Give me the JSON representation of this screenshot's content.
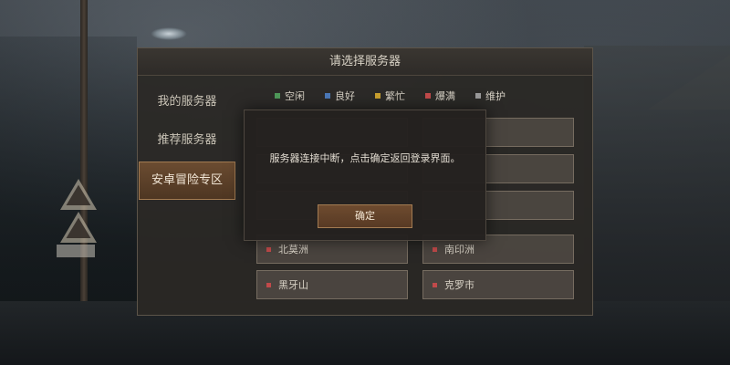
{
  "panel": {
    "title": "请选择服务器",
    "sidebar": [
      "我的服务器",
      "推荐服务器",
      "安卓冒险专区"
    ],
    "legend": [
      {
        "label": "空闲",
        "color": "#4f9a5a"
      },
      {
        "label": "良好",
        "color": "#4b78b8"
      },
      {
        "label": "繁忙",
        "color": "#c8a02e"
      },
      {
        "label": "爆满",
        "color": "#c14a4a"
      },
      {
        "label": "维护",
        "color": "#9a9a9a"
      }
    ],
    "servers": [
      "北莫洲",
      "南印洲",
      "黑牙山",
      "克罗市"
    ]
  },
  "modal": {
    "message": "服务器连接中断，点击确定返回登录界面。",
    "confirm_label": "确定"
  }
}
